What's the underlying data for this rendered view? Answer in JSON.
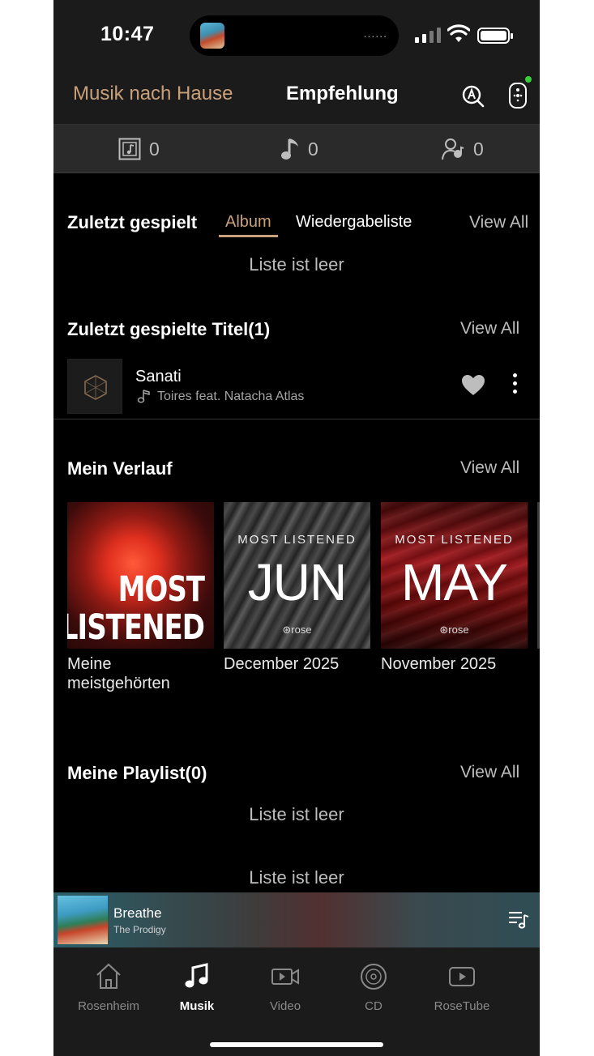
{
  "status_bar": {
    "time": "10:47",
    "island_dots": "......"
  },
  "header": {
    "left_label": "Musik nach Hause",
    "title": "Empfehlung"
  },
  "counters": [
    {
      "icon": "album-icon",
      "value": "0"
    },
    {
      "icon": "music-note-icon",
      "value": "0"
    },
    {
      "icon": "artist-icon",
      "value": "0"
    }
  ],
  "recently_played": {
    "title": "Zuletzt gespielt",
    "tabs": [
      "Album",
      "Wiedergabeliste"
    ],
    "active_tab": "Album",
    "view_all": "View All",
    "empty": "Liste ist leer"
  },
  "recent_tracks": {
    "title": "Zuletzt gespielte Titel(1)",
    "view_all": "View All",
    "items": [
      {
        "title": "Sanati",
        "artist": "Toires feat. Natacha Atlas"
      }
    ]
  },
  "history": {
    "title": "Mein Verlauf",
    "view_all": "View All",
    "cards": [
      {
        "art_line1": "MOST",
        "art_line2": "LISTENED",
        "label": "Meine meistgehörten"
      },
      {
        "art_small": "MOST LISTENED",
        "art_big": "JUN",
        "brand": "⊛rose",
        "label": "December 2025"
      },
      {
        "art_small": "MOST LISTENED",
        "art_big": "MAY",
        "brand": "⊛rose",
        "label": "November 2025"
      }
    ]
  },
  "my_playlist": {
    "title": "Meine Playlist(0)",
    "view_all": "View All",
    "empty": "Liste ist leer",
    "empty2": "Liste ist leer"
  },
  "now_playing": {
    "title": "Breathe",
    "artist": "The Prodigy"
  },
  "bottom_nav": [
    {
      "label": "Rosenheim",
      "icon": "home-icon",
      "active": false
    },
    {
      "label": "Musik",
      "icon": "music-icon",
      "active": true
    },
    {
      "label": "Video",
      "icon": "video-icon",
      "active": false
    },
    {
      "label": "CD",
      "icon": "cd-icon",
      "active": false
    },
    {
      "label": "RoseTube",
      "icon": "play-icon",
      "active": false
    }
  ],
  "colors": {
    "accent": "#c9a07a",
    "background": "#000000",
    "panel": "#1b1b1b",
    "status_green": "#37d03c"
  }
}
